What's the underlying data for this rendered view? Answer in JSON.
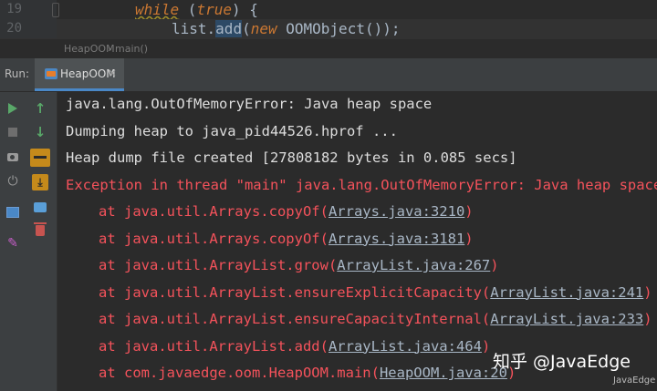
{
  "editor": {
    "line_numbers": [
      "19",
      "20"
    ],
    "line19": {
      "kw": "while",
      "rest": " (",
      "kw2": "true",
      "end": ") {"
    },
    "line20": {
      "pre": "list.",
      "method": "add",
      "open": "(",
      "kw": "new",
      "rest": " OOMObject());"
    }
  },
  "breadcrumb": {
    "class_name": "HeapOOM",
    "separator": "›",
    "method": "main()"
  },
  "run_window": {
    "label": "Run:",
    "tab_label": "HeapOOM",
    "close_glyph": "×"
  },
  "toolbar": {
    "icons": [
      "run-icon",
      "stop-icon",
      "camera-icon",
      "plug-icon",
      "layout-icon",
      "pin-icon",
      "up-arrow-icon",
      "down-arrow-icon",
      "soft-wrap-icon",
      "scroll-to-end-icon",
      "print-icon",
      "trash-icon"
    ],
    "up_glyph": "↑",
    "down_glyph": "↓",
    "plug_glyph": "⏻",
    "pin_glyph": "✎",
    "download_glyph": "⤓"
  },
  "console": {
    "stdout": [
      "java.lang.OutOfMemoryError: Java heap space",
      "Dumping heap to java_pid44526.hprof ...",
      "Heap dump file created [27808182 bytes in 0.085 secs]"
    ],
    "exception_header": "Exception in thread \"main\" java.lang.OutOfMemoryError: Java heap space",
    "stack_trace": [
      {
        "prefix": "at java.util.Arrays.copyOf(",
        "link": "Arrays.java:3210",
        "suffix": ")"
      },
      {
        "prefix": "at java.util.Arrays.copyOf(",
        "link": "Arrays.java:3181",
        "suffix": ")"
      },
      {
        "prefix": "at java.util.ArrayList.grow(",
        "link": "ArrayList.java:267",
        "suffix": ")"
      },
      {
        "prefix": "at java.util.ArrayList.ensureExplicitCapacity(",
        "link": "ArrayList.java:241",
        "suffix": ")"
      },
      {
        "prefix": "at java.util.ArrayList.ensureCapacityInternal(",
        "link": "ArrayList.java:233",
        "suffix": ")"
      },
      {
        "prefix": "at java.util.ArrayList.add(",
        "link": "ArrayList.java:464",
        "suffix": ")"
      },
      {
        "prefix": "at com.javaedge.oom.HeapOOM.main(",
        "link": "HeapOOM.java:20",
        "suffix": ")"
      }
    ]
  },
  "watermark": {
    "main": "知乎 @JavaEdge",
    "small": "JavaEdge"
  },
  "colors": {
    "error": "#f4525b",
    "stdout": "#dddddd",
    "keyword": "#cc7832",
    "accent": "#4a88c7"
  }
}
